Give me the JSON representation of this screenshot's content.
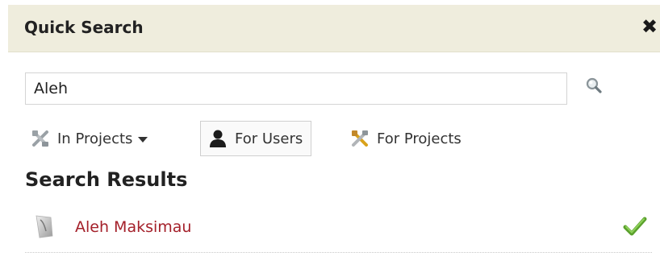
{
  "header": {
    "title": "Quick Search",
    "close_glyph": "✖"
  },
  "search": {
    "value": "Aleh",
    "placeholder": "",
    "button_icon": "magnifier-icon"
  },
  "filters": [
    {
      "label": "In Projects",
      "icon": "project-tools-icon",
      "dropdown": true,
      "selected": false
    },
    {
      "label": "For Users",
      "icon": "user-icon",
      "dropdown": false,
      "selected": true
    },
    {
      "label": "For Projects",
      "icon": "project-tools-icon",
      "dropdown": false,
      "selected": false
    }
  ],
  "results": {
    "title": "Search Results",
    "items": [
      {
        "name": "Aleh Maksimau",
        "avatar_icon": "avatar-icon",
        "status_icon": "checkmark-icon"
      }
    ]
  },
  "colors": {
    "header_bg": "#efeddd",
    "result_link": "#a4202a",
    "check_green": "#5aa02c"
  }
}
